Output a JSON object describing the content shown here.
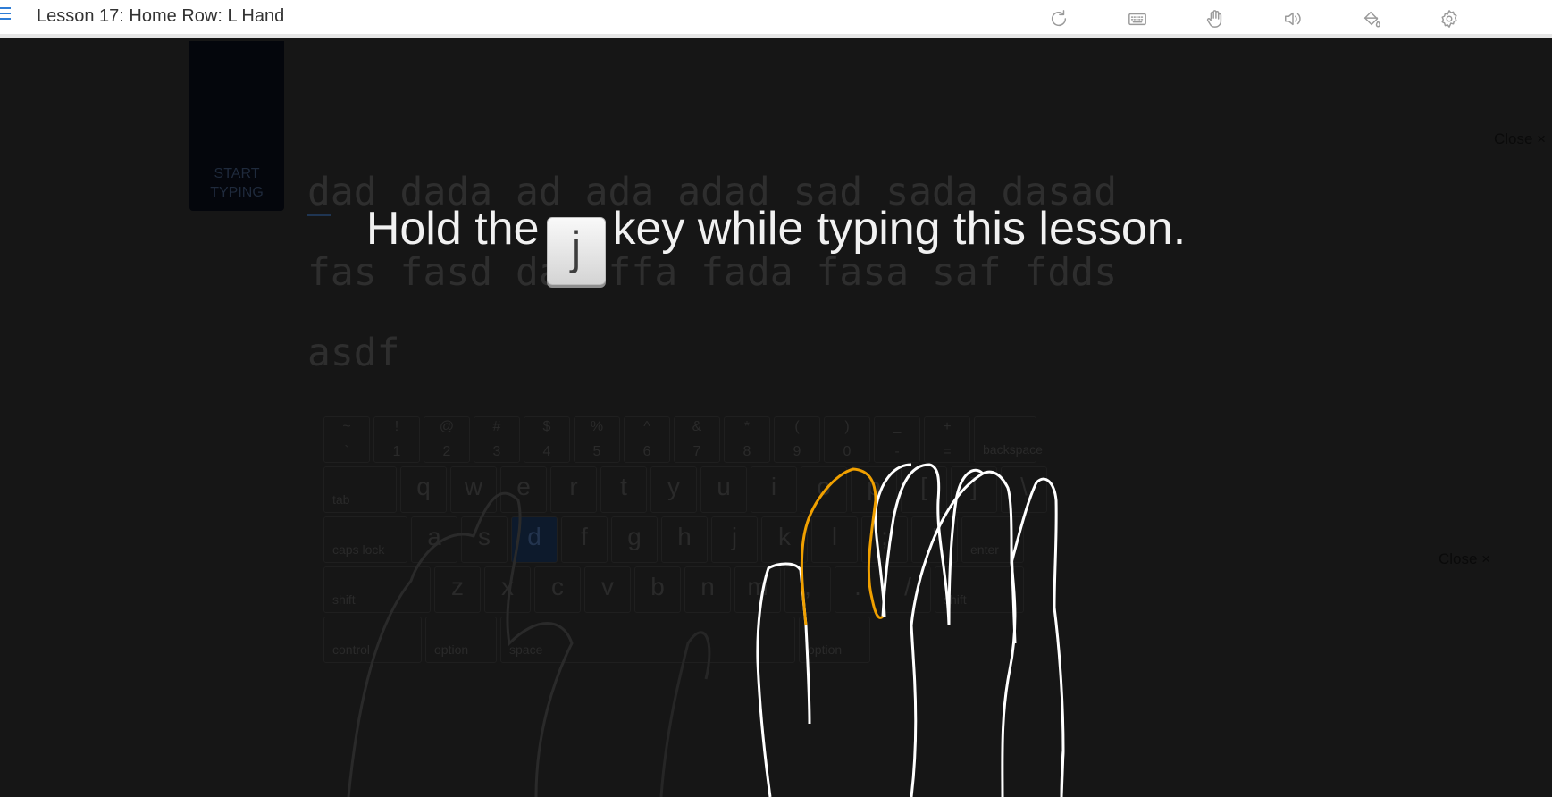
{
  "header": {
    "lesson_title": "Lesson 17: Home Row: L Hand",
    "tools": [
      {
        "name": "restart-icon"
      },
      {
        "name": "keyboard-icon"
      },
      {
        "name": "hand-icon"
      },
      {
        "name": "sound-icon"
      },
      {
        "name": "theme-bucket-icon"
      },
      {
        "name": "settings-gear-icon"
      }
    ]
  },
  "start_panel": {
    "label_line1": "START",
    "label_line2": "TYPING"
  },
  "lesson_text": {
    "lines": [
      "dad dada ad ada adad sad sada dasad",
      "fas fasd dad ffa fada fasa saf fdds",
      "asdf"
    ]
  },
  "close_links": {
    "top": "Close ×",
    "middle": "Close ×"
  },
  "overlay": {
    "text_before": "Hold the",
    "key": "j",
    "text_after": "key while typing this lesson."
  },
  "keyboard": {
    "number_row": [
      {
        "top": "~",
        "bottom": "`"
      },
      {
        "top": "!",
        "bottom": "1"
      },
      {
        "top": "@",
        "bottom": "2"
      },
      {
        "top": "#",
        "bottom": "3"
      },
      {
        "top": "$",
        "bottom": "4"
      },
      {
        "top": "%",
        "bottom": "5"
      },
      {
        "top": "^",
        "bottom": "6"
      },
      {
        "top": "&",
        "bottom": "7"
      },
      {
        "top": "*",
        "bottom": "8"
      },
      {
        "top": "(",
        "bottom": "9"
      },
      {
        "top": ")",
        "bottom": "0"
      },
      {
        "top": "_",
        "bottom": "-"
      },
      {
        "top": "+",
        "bottom": "="
      }
    ],
    "backspace": "backspace",
    "tab": "tab",
    "top_row": [
      "q",
      "w",
      "e",
      "r",
      "t",
      "y",
      "u",
      "i",
      "o",
      "p",
      "[",
      "]",
      "\\"
    ],
    "caps": "caps lock",
    "home_row": [
      "a",
      "s",
      "d",
      "f",
      "g",
      "h",
      "j",
      "k",
      "l",
      ";",
      "'"
    ],
    "enter": "enter",
    "shift_left": "shift",
    "bottom_row": [
      "z",
      "x",
      "c",
      "v",
      "b",
      "n",
      "m",
      ",",
      ".",
      "/"
    ],
    "shift_right": "shift",
    "control": "control",
    "option_left": "option",
    "space": "space",
    "option_right": "option",
    "active_key": "d"
  },
  "colors": {
    "active_finger": "#f0a000",
    "hand_outline": "#ffffff",
    "accent": "#2f7dd6"
  }
}
